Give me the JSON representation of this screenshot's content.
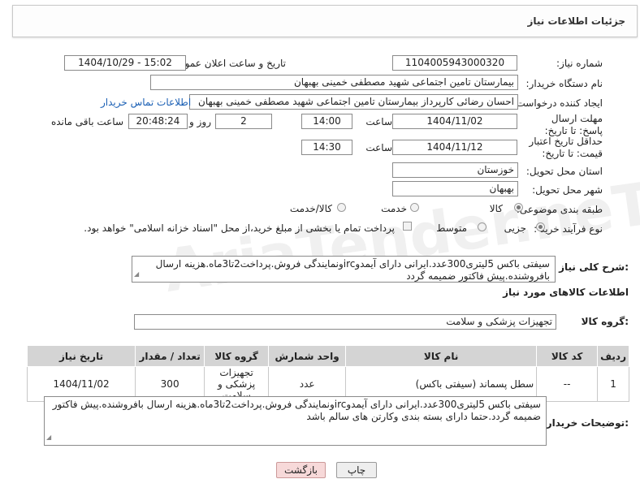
{
  "header": {
    "title": "جزئیات اطلاعات نیاز"
  },
  "form": {
    "need_number_label": "شماره نیاز:",
    "need_number": "1104005943000320",
    "announce_label": "تاریخ و ساعت اعلان عمومی:",
    "announce_value": "1404/10/29 - 15:02",
    "buyer_label": "نام دستگاه خریدار:",
    "buyer_value": "بیمارستان تامین اجتماعی شهید مصطفی خمینی بهبهان",
    "creator_label": "ایجاد کننده درخواست:",
    "creator_value": "احسان رضائی کارپرداز بیمارستان تامین اجتماعی شهید مصطفی خمینی بهبهان",
    "contact_link": "اطلاعات تماس خریدار",
    "deadline_label": "مهلت ارسال پاسخ: تا تاریخ:",
    "deadline_date": "1404/11/02",
    "time_label": "ساعت",
    "deadline_time": "14:00",
    "days_value": "2",
    "days_label": "روز و",
    "remaining_time": "20:48:24",
    "remaining_label": "ساعت باقی مانده",
    "validity_label": "حداقل تاریخ اعتبار قیمت: تا تاریخ:",
    "validity_date": "1404/11/12",
    "validity_time": "14:30",
    "province_label": "استان محل تحویل:",
    "province_value": "خوزستان",
    "city_label": "شهر محل تحویل:",
    "city_value": "بهبهان",
    "category_label": "طبقه بندی موضوعی:",
    "category_options": [
      "کالا",
      "خدمت",
      "کالا/خدمت"
    ],
    "category_selected": "کالا",
    "process_label": "نوع فرآیند خرید :",
    "process_options": [
      "جزیی",
      "متوسط"
    ],
    "process_selected": "جزیی",
    "payment_note": "پرداخت تمام یا بخشی از مبلغ خرید،از محل \"اسناد خزانه اسلامی\" خواهد بود."
  },
  "description": {
    "label": "شرح کلی نیاز:",
    "text": "سیفتی باکس 5لیتری300عدد.ایرانی دارای آیمدوircونمایندگی فروش.پرداخت2تا3ماه.هزینه ارسال بافروشنده.پیش فاکتور ضمیمه گردد"
  },
  "goods": {
    "section_title": "اطلاعات کالاهای مورد نیاز",
    "group_label": "گروه کالا:",
    "group_value": "تجهیزات پزشکی و سلامت",
    "columns": [
      "ردیف",
      "کد کالا",
      "نام کالا",
      "واحد شمارش",
      "گروه کالا",
      "تعداد / مقدار",
      "تاریخ نیاز"
    ],
    "rows": [
      {
        "index": "1",
        "code": "--",
        "name": "سطل پسماند (سیفتی باکس)",
        "unit": "عدد",
        "group": "تجهیزات پزشکی و سلامت",
        "qty": "300",
        "date": "1404/11/02"
      }
    ]
  },
  "buyer_notes": {
    "label": "توضیحات خریدار:",
    "text": "سیفتی باکس 5لیتری300عدد.ایرانی دارای آیمدوircونمایندگی فروش.پرداخت2تا3ماه.هزینه ارسال بافروشنده.پیش فاکتور ضمیمه گردد.حتما دارای بسته بندی وکارتن های سالم باشد"
  },
  "buttons": {
    "print": "چاپ",
    "back": "بازگشت"
  },
  "colors": {
    "link": "#1a5fb4",
    "back_button_bg": "#f7d9d9",
    "header_bg": "#d4d4d4"
  }
}
